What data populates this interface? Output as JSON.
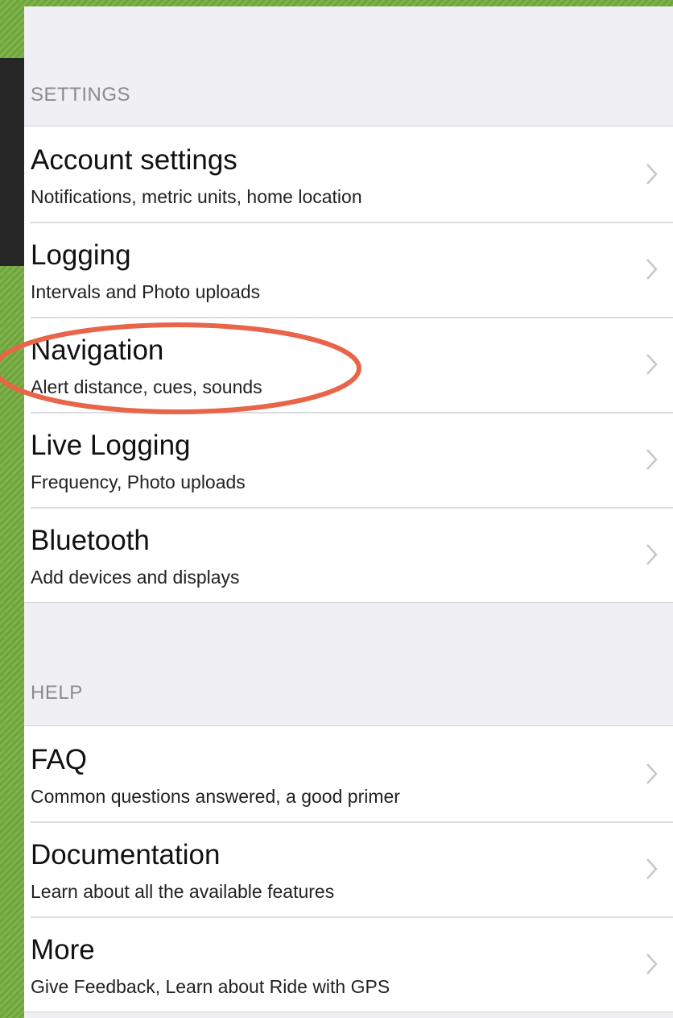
{
  "settings": {
    "header": "SETTINGS",
    "items": [
      {
        "title": "Account settings",
        "subtitle": "Notifications, metric units, home location"
      },
      {
        "title": "Logging",
        "subtitle": "Intervals and Photo uploads"
      },
      {
        "title": "Navigation",
        "subtitle": "Alert distance, cues, sounds"
      },
      {
        "title": "Live Logging",
        "subtitle": "Frequency, Photo uploads"
      },
      {
        "title": "Bluetooth",
        "subtitle": "Add devices and displays"
      }
    ]
  },
  "help": {
    "header": "HELP",
    "items": [
      {
        "title": "FAQ",
        "subtitle": "Common questions answered, a good primer"
      },
      {
        "title": "Documentation",
        "subtitle": "Learn about all the available features"
      },
      {
        "title": "More",
        "subtitle": "Give Feedback, Learn about Ride with GPS"
      }
    ]
  },
  "colors": {
    "background_green": "#7db34a",
    "highlight_circle": "#e8654a",
    "chevron": "#c7c7cc"
  },
  "icons": {
    "row_disclosure": "chevron-right-icon"
  }
}
